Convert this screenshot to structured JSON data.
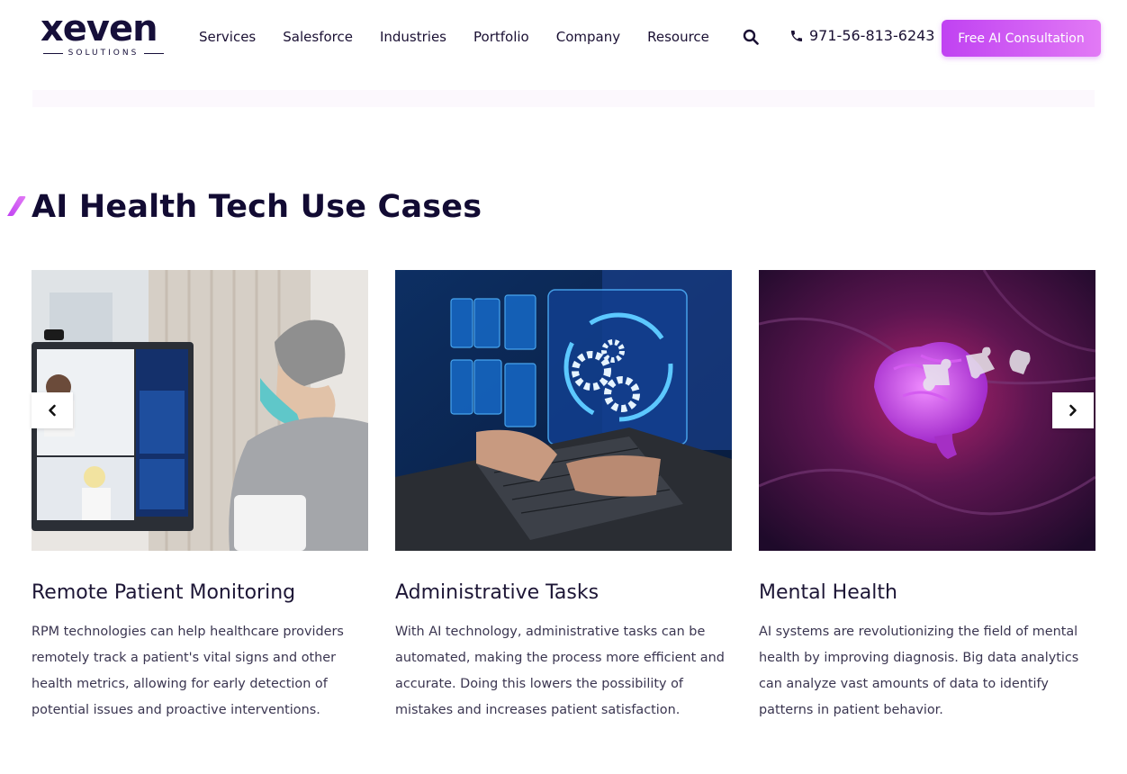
{
  "header": {
    "logo_word": "xeven",
    "logo_sub": "SOLUTIONS",
    "nav": [
      "Services",
      "Salesforce",
      "Industries",
      "Portfolio",
      "Company",
      "Resource"
    ],
    "phone": "971-56-813-6243",
    "cta_label": "Free AI Consultation"
  },
  "section": {
    "title": "AI Health Tech Use Cases"
  },
  "cards": [
    {
      "title": "Remote Patient Monitoring",
      "description": "RPM technologies can help healthcare providers remotely track a patient's vital signs and other health metrics, allowing for early detection of potential issues and proactive interventions."
    },
    {
      "title": "Administrative Tasks",
      "description": "With AI technology, administrative tasks can be automated, making the process more efficient and accurate. Doing this lowers the possibility of mistakes and increases patient satisfaction."
    },
    {
      "title": "Mental Health",
      "description": "AI systems are revolutionizing the field of mental health by improving diagnosis. Big data analytics can analyze vast amounts of data to identify patterns in patient behavior."
    }
  ],
  "colors": {
    "brand": "#160f3a",
    "accent_start": "#c042f2",
    "accent_end": "#e27af5"
  },
  "icons": {
    "search": "search-icon",
    "phone": "phone-icon",
    "prev": "chevron-left-icon",
    "next": "chevron-right-icon"
  }
}
